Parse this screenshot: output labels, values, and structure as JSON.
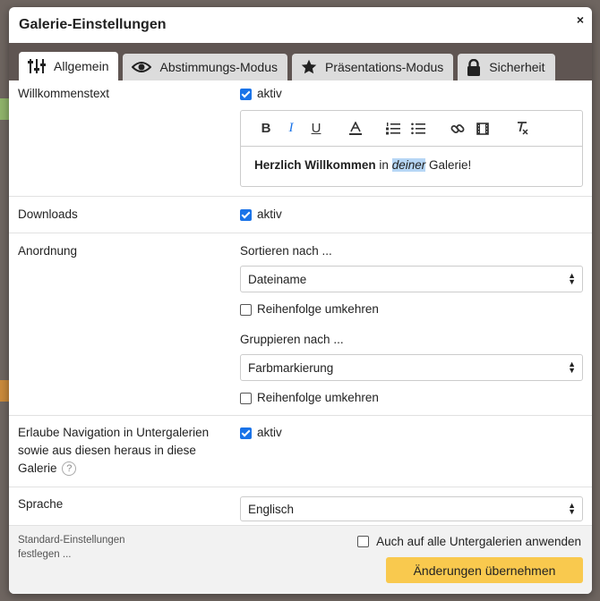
{
  "dialog": {
    "title": "Galerie-Einstellungen",
    "close_icon": "×"
  },
  "tabs": [
    {
      "label": "Allgemein",
      "icon": "sliders-icon"
    },
    {
      "label": "Abstimmungs-Modus",
      "icon": "eye-icon"
    },
    {
      "label": "Präsentations-Modus",
      "icon": "star-icon"
    },
    {
      "label": "Sicherheit",
      "icon": "lock-icon"
    }
  ],
  "welcome": {
    "label": "Willkommenstext",
    "checkbox_label": "aktiv",
    "checked": true,
    "editor_text": {
      "bold": "Herzlich Willkommen",
      "plain1": " in ",
      "italic": "deiner",
      "plain2": " Galerie!"
    }
  },
  "downloads": {
    "label": "Downloads",
    "checkbox_label": "aktiv",
    "checked": true
  },
  "order": {
    "label": "Anordnung",
    "sort_label": "Sortieren nach ...",
    "sort_value": "Dateiname",
    "reverse1": "Reihenfolge umkehren",
    "group_label": "Gruppieren nach ...",
    "group_value": "Farbmarkierung",
    "reverse2": "Reihenfolge umkehren"
  },
  "navigation": {
    "label": "Erlaube Navigation in Untergalerien sowie aus diesen heraus in diese Galerie",
    "checkbox_label": "aktiv",
    "help": "?"
  },
  "language": {
    "label": "Sprache",
    "value": "Englisch"
  },
  "footer": {
    "defaults_link": "Standard-Einstellungen festlegen ...",
    "apply_all": "Auch auf alle Untergalerien anwenden",
    "apply_button": "Änderungen übernehmen"
  },
  "colors": {
    "accent": "#1a73e8",
    "button": "#f9c94e",
    "tabbar": "#5f5552"
  }
}
